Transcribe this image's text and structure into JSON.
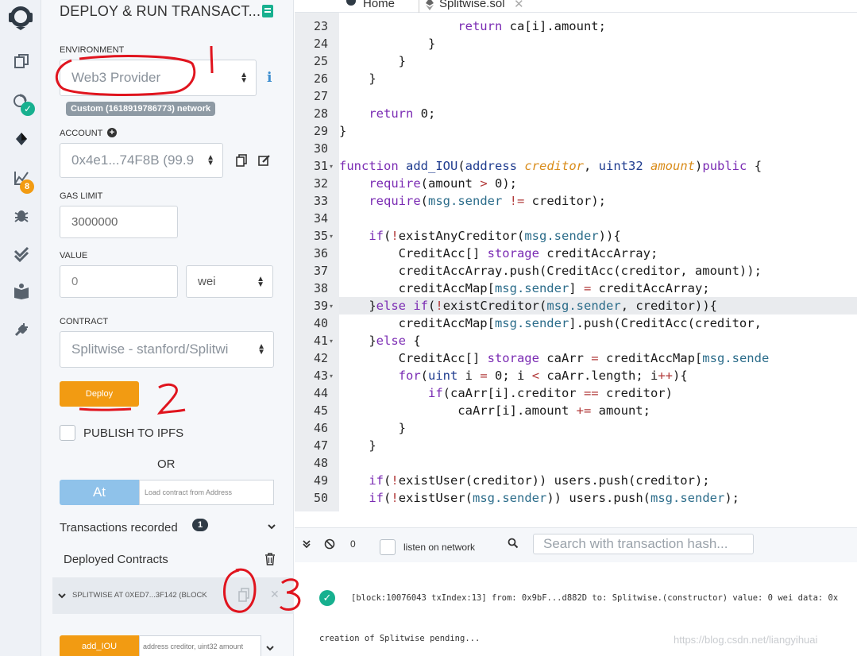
{
  "tabs": [
    {
      "label": "Home"
    },
    {
      "label": "Splitwise.sol"
    }
  ],
  "panel": {
    "title": "DEPLOY & RUN TRANSACT...",
    "environment_label": "ENVIRONMENT",
    "environment_value": "Web3 Provider",
    "network_tag": "Custom (1618919786773) network",
    "account_label": "ACCOUNT",
    "account_value": "0x4e1...74F8B (99.9",
    "gas_limit_label": "GAS LIMIT",
    "gas_limit_value": "3000000",
    "value_label": "VALUE",
    "value_value": "0",
    "value_unit": "wei",
    "contract_label": "CONTRACT",
    "contract_value": "Splitwise - stanford/Splitwi",
    "deploy_label": "Deploy",
    "publish_label": "PUBLISH TO IPFS",
    "or_label": "OR",
    "at_label": "At",
    "at_placeholder": "Load contract from Address",
    "tx_recorded_label": "Transactions recorded",
    "tx_recorded_count": "1",
    "deployed_label": "Deployed Contracts",
    "deployed_item": "SPLITWISE AT 0XED7...3F142 (BLOCK",
    "add_iou_label": "add_IOU",
    "add_iou_placeholder": "address creditor, uint32 amount"
  },
  "rail": {
    "badge_count": "8"
  },
  "editor": {
    "line_numbers": [
      "23",
      "24",
      "25",
      "26",
      "27",
      "28",
      "29",
      "30",
      "31",
      "32",
      "33",
      "34",
      "35",
      "36",
      "37",
      "38",
      "39",
      "40",
      "41",
      "42",
      "43",
      "44",
      "45",
      "46",
      "47",
      "48",
      "49",
      "50"
    ],
    "folded_lines": [
      "31",
      "35",
      "39",
      "41",
      "43"
    ]
  },
  "terminal": {
    "pending_count": "0",
    "listen_label": "listen on network",
    "search_placeholder": "Search with transaction hash...",
    "log_line": "[block:10076043 txIndex:13]  from: 0x9bF...d882D to: Splitwise.(constructor) value: 0 wei data: 0x",
    "pending_line": "creation of Splitwise pending..."
  },
  "watermark": "https://blog.csdn.net/liangyihuai",
  "annotations": [
    "1",
    "2",
    "3"
  ],
  "colors": {
    "accent_orange": "#f29b12",
    "success_green": "#17b08f",
    "at_blue": "#8fc2ea",
    "annotation_red": "#e0141e"
  }
}
